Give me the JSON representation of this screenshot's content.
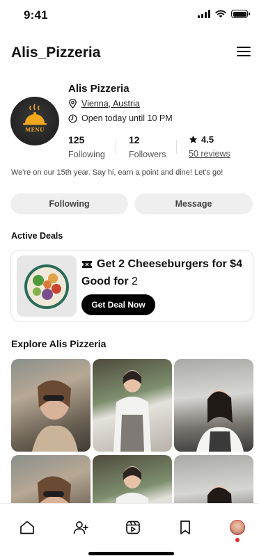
{
  "status_bar": {
    "time": "9:41"
  },
  "header": {
    "title": "Alis_Pizzeria"
  },
  "profile": {
    "name": "Alis Pizzeria",
    "location": "Vienna, Austria",
    "hours": "Open today until 10 PM",
    "avatar_text": "MENU",
    "stats": [
      {
        "value": "125",
        "label": "Following"
      },
      {
        "value": "12",
        "label": "Followers"
      },
      {
        "value": "4.5",
        "label": "50 reviews"
      }
    ],
    "bio": "We're on our 15th year. Say hi, earn a point and dine! Let's go!"
  },
  "actions": {
    "following_label": "Following",
    "message_label": "Message"
  },
  "deals": {
    "section_title": "Active Deals",
    "title": "Get 2 Cheeseburgers for $4",
    "good_for_label": "Good for",
    "good_for_count": "2",
    "button_label": "Get Deal Now"
  },
  "explore": {
    "section_title": "Explore Alis Pizzeria",
    "photos": [
      "photo",
      "photo",
      "photo",
      "photo",
      "photo",
      "photo"
    ]
  },
  "nav": {
    "items": [
      "home-icon",
      "add-user-icon",
      "reels-icon",
      "bookmark-icon",
      "profile-avatar"
    ],
    "accent": "#e0262c"
  }
}
